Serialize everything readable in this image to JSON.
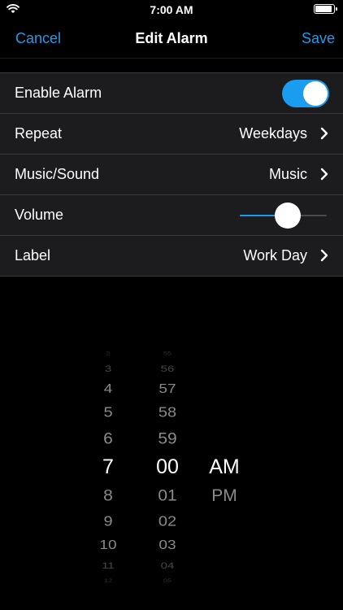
{
  "status_bar": {
    "time": "7:00 AM",
    "wifi_icon": "wifi-icon",
    "battery_icon": "battery-icon"
  },
  "nav": {
    "cancel": "Cancel",
    "title": "Edit Alarm",
    "save": "Save"
  },
  "settings": {
    "enable_alarm": {
      "label": "Enable Alarm",
      "enabled": true
    },
    "repeat": {
      "label": "Repeat",
      "value": "Weekdays"
    },
    "music": {
      "label": "Music/Sound",
      "value": "Music"
    },
    "volume": {
      "label": "Volume",
      "level_percent": 55
    },
    "label": {
      "label": "Label",
      "value": "Work Day"
    }
  },
  "picker": {
    "hours": [
      "2",
      "3",
      "4",
      "5",
      "6",
      "7",
      "8",
      "9",
      "10",
      "11",
      "12"
    ],
    "minutes": [
      "55",
      "56",
      "57",
      "58",
      "59",
      "00",
      "01",
      "02",
      "03",
      "04",
      "05"
    ],
    "ampm": [
      "AM",
      "PM"
    ],
    "selected": {
      "hour": "7",
      "minute": "00",
      "ampm": "AM"
    }
  },
  "colors": {
    "accent": "#1a9cf0",
    "background": "#000000",
    "cell": "#1c1c1e",
    "separator": "#3a3a3c"
  }
}
